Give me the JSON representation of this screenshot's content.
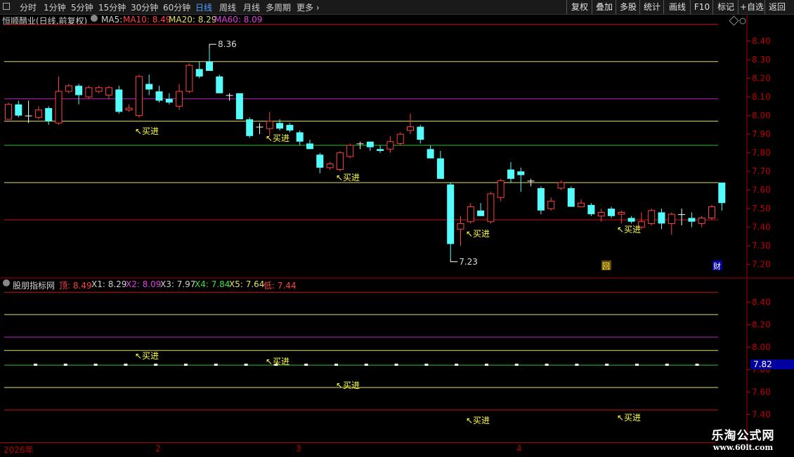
{
  "toolbar": {
    "tabs": [
      "分时",
      "1分钟",
      "5分钟",
      "15分钟",
      "30分钟",
      "60分钟",
      "日线",
      "周线",
      "月线",
      "多周期",
      "更多 ›"
    ],
    "active_tab": "日线",
    "right_buttons": [
      "复权",
      "叠加",
      "多股",
      "统计",
      "画线",
      "F10",
      "标记",
      "+自选",
      "返回"
    ]
  },
  "main_header": {
    "title": "恒顺醋业(日线,前复权)",
    "ma5_label": "MA5:",
    "ma10": "MA10: 8.49",
    "ma20": "MA20: 8.29",
    "ma60": "MA60: 8.09"
  },
  "indicator_header": {
    "name": "股朋指标网",
    "top": "顶: 8.49",
    "x1": "X1: 8.29",
    "x2": "X2: 8.09",
    "x3": "X3: 7.97",
    "x4": "X4: 7.84",
    "x5": "X5: 7.64",
    "low": "低: 7.44"
  },
  "colors": {
    "up": "#ff4040",
    "down": "#54fcfc",
    "red_line": "#c81414",
    "yellow_line": "#e0e060",
    "magenta_line": "#c020c0",
    "green_line": "#30c030",
    "buy_signal": "#ffff40",
    "axis_text": "#c00000",
    "highlight": "#0000a0"
  },
  "chart_data": [
    {
      "type": "candlestick",
      "title": "恒顺醋业(日线,前复权)",
      "ylim": [
        7.15,
        8.47
      ],
      "yticks": [
        "8.40",
        "8.30",
        "8.20",
        "8.10",
        "8.00",
        "7.90",
        "7.80",
        "7.70",
        "7.60",
        "7.50",
        "7.40",
        "7.30",
        "7.20"
      ],
      "hlines": [
        {
          "value": 8.49,
          "color": "red"
        },
        {
          "value": 8.29,
          "color": "yellow"
        },
        {
          "value": 8.09,
          "color": "magenta"
        },
        {
          "value": 7.97,
          "color": "yellow"
        },
        {
          "value": 7.84,
          "color": "green"
        },
        {
          "value": 7.64,
          "color": "yellow"
        },
        {
          "value": 7.44,
          "color": "red"
        }
      ],
      "candles": [
        {
          "o": 7.98,
          "h": 8.07,
          "l": 7.98,
          "c": 8.06
        },
        {
          "o": 8.06,
          "h": 8.08,
          "l": 7.99,
          "c": 8.0
        },
        {
          "o": 8.0,
          "h": 8.08,
          "l": 7.96,
          "c": 8.0
        },
        {
          "o": 7.99,
          "h": 8.05,
          "l": 7.98,
          "c": 8.03
        },
        {
          "o": 8.04,
          "h": 8.05,
          "l": 7.95,
          "c": 7.97
        },
        {
          "o": 7.96,
          "h": 8.21,
          "l": 7.95,
          "c": 8.13
        },
        {
          "o": 8.13,
          "h": 8.17,
          "l": 8.12,
          "c": 8.16
        },
        {
          "o": 8.16,
          "h": 8.17,
          "l": 8.06,
          "c": 8.11
        },
        {
          "o": 8.1,
          "h": 8.16,
          "l": 8.09,
          "c": 8.15
        },
        {
          "o": 8.13,
          "h": 8.16,
          "l": 8.12,
          "c": 8.15
        },
        {
          "o": 8.11,
          "h": 8.16,
          "l": 8.09,
          "c": 8.15
        },
        {
          "o": 8.14,
          "h": 8.16,
          "l": 8.01,
          "c": 8.02
        },
        {
          "o": 8.03,
          "h": 8.06,
          "l": 8.02,
          "c": 8.04
        },
        {
          "o": 8.0,
          "h": 8.22,
          "l": 7.99,
          "c": 8.21
        },
        {
          "o": 8.17,
          "h": 8.22,
          "l": 8.11,
          "c": 8.14
        },
        {
          "o": 8.13,
          "h": 8.16,
          "l": 8.07,
          "c": 8.08
        },
        {
          "o": 8.09,
          "h": 8.12,
          "l": 8.06,
          "c": 8.07
        },
        {
          "o": 8.05,
          "h": 8.17,
          "l": 8.03,
          "c": 8.13
        },
        {
          "o": 8.13,
          "h": 8.28,
          "l": 8.12,
          "c": 8.27
        },
        {
          "o": 8.25,
          "h": 8.29,
          "l": 8.2,
          "c": 8.21
        },
        {
          "o": 8.29,
          "h": 8.36,
          "l": 8.24,
          "c": 8.24
        },
        {
          "o": 8.21,
          "h": 8.22,
          "l": 8.12,
          "c": 8.12
        },
        {
          "o": 8.11,
          "h": 8.12,
          "l": 8.08,
          "c": 8.11
        },
        {
          "o": 8.12,
          "h": 8.12,
          "l": 7.98,
          "c": 7.98
        },
        {
          "o": 7.98,
          "h": 7.99,
          "l": 7.88,
          "c": 7.89
        },
        {
          "o": 7.94,
          "h": 7.96,
          "l": 7.9,
          "c": 7.94
        },
        {
          "o": 7.93,
          "h": 8.02,
          "l": 7.89,
          "c": 7.97
        },
        {
          "o": 7.96,
          "h": 7.98,
          "l": 7.92,
          "c": 7.93
        },
        {
          "o": 7.95,
          "h": 7.96,
          "l": 7.91,
          "c": 7.92
        },
        {
          "o": 7.91,
          "h": 7.92,
          "l": 7.84,
          "c": 7.86
        },
        {
          "o": 7.85,
          "h": 7.87,
          "l": 7.82,
          "c": 7.82
        },
        {
          "o": 7.79,
          "h": 7.8,
          "l": 7.69,
          "c": 7.72
        },
        {
          "o": 7.72,
          "h": 7.75,
          "l": 7.71,
          "c": 7.74
        },
        {
          "o": 7.71,
          "h": 7.81,
          "l": 7.7,
          "c": 7.8
        },
        {
          "o": 7.78,
          "h": 7.85,
          "l": 7.77,
          "c": 7.84
        },
        {
          "o": 7.85,
          "h": 7.86,
          "l": 7.82,
          "c": 7.85
        },
        {
          "o": 7.86,
          "h": 7.86,
          "l": 7.81,
          "c": 7.83
        },
        {
          "o": 7.82,
          "h": 7.84,
          "l": 7.8,
          "c": 7.81
        },
        {
          "o": 7.82,
          "h": 7.89,
          "l": 7.8,
          "c": 7.86
        },
        {
          "o": 7.85,
          "h": 7.91,
          "l": 7.84,
          "c": 7.9
        },
        {
          "o": 7.92,
          "h": 8.01,
          "l": 7.9,
          "c": 7.94
        },
        {
          "o": 7.94,
          "h": 7.95,
          "l": 7.85,
          "c": 7.87
        },
        {
          "o": 7.82,
          "h": 7.84,
          "l": 7.77,
          "c": 7.77
        },
        {
          "o": 7.77,
          "h": 7.81,
          "l": 7.66,
          "c": 7.66
        },
        {
          "o": 7.63,
          "h": 7.64,
          "l": 7.23,
          "c": 7.31
        },
        {
          "o": 7.39,
          "h": 7.46,
          "l": 7.3,
          "c": 7.42
        },
        {
          "o": 7.43,
          "h": 7.53,
          "l": 7.42,
          "c": 7.51
        },
        {
          "o": 7.49,
          "h": 7.53,
          "l": 7.46,
          "c": 7.46
        },
        {
          "o": 7.43,
          "h": 7.59,
          "l": 7.42,
          "c": 7.58
        },
        {
          "o": 7.56,
          "h": 7.66,
          "l": 7.54,
          "c": 7.65
        },
        {
          "o": 7.71,
          "h": 7.75,
          "l": 7.64,
          "c": 7.66
        },
        {
          "o": 7.7,
          "h": 7.72,
          "l": 7.59,
          "c": 7.68
        },
        {
          "o": 7.65,
          "h": 7.66,
          "l": 7.62,
          "c": 7.65
        },
        {
          "o": 7.61,
          "h": 7.62,
          "l": 7.47,
          "c": 7.49
        },
        {
          "o": 7.5,
          "h": 7.56,
          "l": 7.49,
          "c": 7.54
        },
        {
          "o": 7.61,
          "h": 7.65,
          "l": 7.6,
          "c": 7.64
        },
        {
          "o": 7.61,
          "h": 7.62,
          "l": 7.51,
          "c": 7.51
        },
        {
          "o": 7.51,
          "h": 7.55,
          "l": 7.51,
          "c": 7.53
        },
        {
          "o": 7.52,
          "h": 7.53,
          "l": 7.46,
          "c": 7.47
        },
        {
          "o": 7.46,
          "h": 7.5,
          "l": 7.43,
          "c": 7.48
        },
        {
          "o": 7.5,
          "h": 7.51,
          "l": 7.45,
          "c": 7.46
        },
        {
          "o": 7.47,
          "h": 7.49,
          "l": 7.42,
          "c": 7.48
        },
        {
          "o": 7.45,
          "h": 7.46,
          "l": 7.42,
          "c": 7.43
        },
        {
          "o": 7.4,
          "h": 7.48,
          "l": 7.39,
          "c": 7.43
        },
        {
          "o": 7.42,
          "h": 7.5,
          "l": 7.41,
          "c": 7.49
        },
        {
          "o": 7.48,
          "h": 7.5,
          "l": 7.39,
          "c": 7.42
        },
        {
          "o": 7.42,
          "h": 7.48,
          "l": 7.36,
          "c": 7.47
        },
        {
          "o": 7.47,
          "h": 7.5,
          "l": 7.41,
          "c": 7.47
        },
        {
          "o": 7.45,
          "h": 7.48,
          "l": 7.4,
          "c": 7.43
        },
        {
          "o": 7.42,
          "h": 7.46,
          "l": 7.4,
          "c": 7.45
        },
        {
          "o": 7.45,
          "h": 7.52,
          "l": 7.44,
          "c": 7.51
        },
        {
          "o": 7.64,
          "h": 7.64,
          "l": 7.49,
          "c": 7.53
        }
      ],
      "annotations": [
        {
          "text": "8.36",
          "kind": "high"
        },
        {
          "text": "7.23",
          "kind": "low"
        }
      ],
      "buy_signals": [
        "↖买进",
        "↖买进",
        "↖买进",
        "↖买进",
        "↖买进"
      ],
      "markers": [
        "回",
        "财"
      ]
    },
    {
      "type": "line",
      "title": "股朋指标网",
      "ylim": [
        7.34,
        8.56
      ],
      "yticks": [
        "8.40",
        "8.20",
        "8.00",
        "7.80",
        "7.60",
        "7.40"
      ],
      "hlines": [
        {
          "value": 8.49,
          "color": "red"
        },
        {
          "value": 8.29,
          "color": "yellow"
        },
        {
          "value": 8.09,
          "color": "magenta"
        },
        {
          "value": 7.97,
          "color": "yellow"
        },
        {
          "value": 7.84,
          "color": "green",
          "dotted": true
        },
        {
          "value": 7.64,
          "color": "yellow"
        },
        {
          "value": 7.44,
          "color": "red"
        }
      ],
      "current_value": "7.82",
      "buy_signals": [
        "↖买进",
        "↖买进",
        "↖买进",
        "↖买进",
        "↖买进"
      ]
    }
  ],
  "date_axis": [
    "2026年",
    "2",
    "3",
    "4"
  ],
  "watermark": {
    "title": "乐淘公式网",
    "url": "www.60lt.com"
  }
}
